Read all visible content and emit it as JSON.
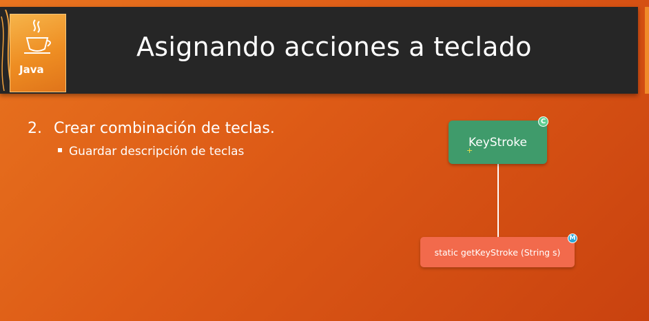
{
  "slide": {
    "title": "Asignando acciones a teclado",
    "logo_text": "Java",
    "bullets": {
      "main_number": "2.",
      "main_text": "Crear combinación de teclas.",
      "sub_text": "Guardar descripción de teclas"
    }
  },
  "diagram": {
    "class_box": {
      "label": "KeyStroke",
      "badge": "C",
      "color": "#3f9b6b"
    },
    "method_box": {
      "label": "static getKeyStroke (String s)",
      "badge": "M",
      "color": "#f26a4c"
    }
  },
  "colors": {
    "background": "#dd5a16",
    "title_bar": "#262626",
    "logo": "#ee8d22",
    "text": "#ffffff"
  },
  "icons": [
    "java-logo-icon",
    "bullet-square-icon",
    "class-badge-icon",
    "method-badge-icon"
  ]
}
